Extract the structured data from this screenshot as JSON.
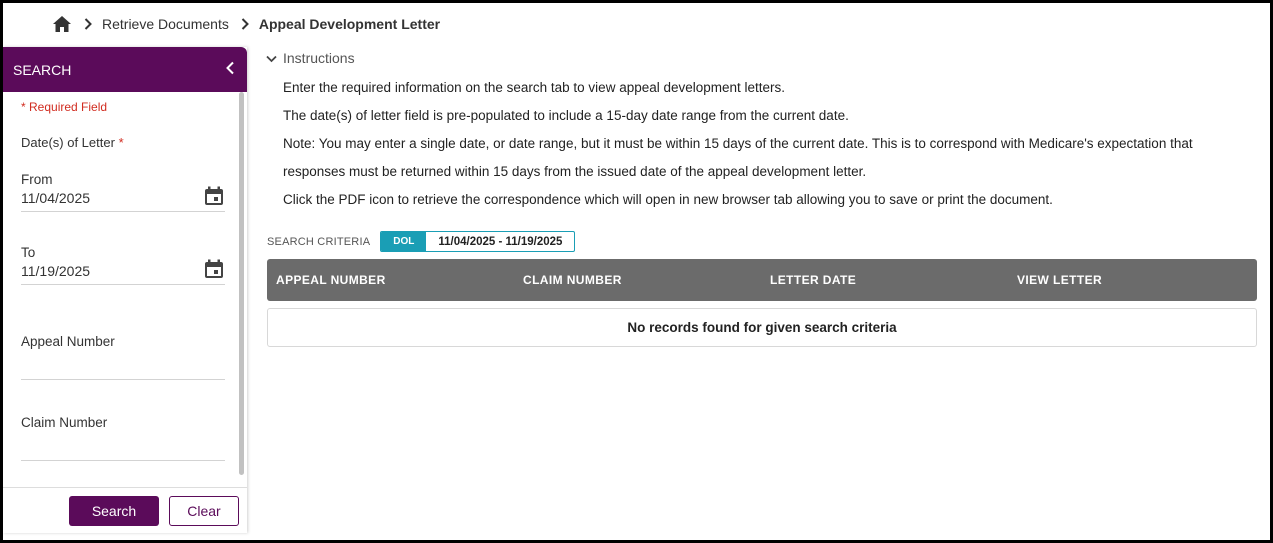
{
  "breadcrumb": {
    "home_icon": "home-icon",
    "items": [
      "Retrieve Documents",
      "Appeal Development Letter"
    ]
  },
  "sidebar": {
    "title": "SEARCH",
    "required_note": "* Required Field",
    "dol_label": "Date(s) of Letter",
    "required_star": "*",
    "from_label": "From",
    "from_value": "11/04/2025",
    "to_label": "To",
    "to_value": "11/19/2025",
    "appeal_label": "Appeal Number",
    "claim_label": "Claim Number",
    "search_button": "Search",
    "clear_button": "Clear"
  },
  "instructions": {
    "toggle_label": "Instructions",
    "lines": [
      "Enter the required information on the search tab to view appeal development letters.",
      "The date(s) of letter field is pre-populated to include a 15-day date range from the current date.",
      "Note: You may enter a single date, or date range, but it must be within 15 days of the current date. This is to correspond with Medicare's expectation that",
      "responses must be returned within 15 days from the issued date of the appeal development letter.",
      "Click the PDF icon to retrieve the correspondence which will open in new browser tab allowing you to save or print the document."
    ]
  },
  "criteria": {
    "label": "SEARCH CRITERIA",
    "chip_key": "DOL",
    "chip_value": "11/04/2025 - 11/19/2025"
  },
  "table": {
    "columns": [
      "APPEAL NUMBER",
      "CLAIM NUMBER",
      "LETTER DATE",
      "VIEW LETTER"
    ],
    "empty_message": "No records found for given search criteria"
  },
  "colors": {
    "brand": "#5b0b5a",
    "accent": "#1a9eb5",
    "table_header": "#6b6b6b",
    "required": "#d12b1f"
  }
}
